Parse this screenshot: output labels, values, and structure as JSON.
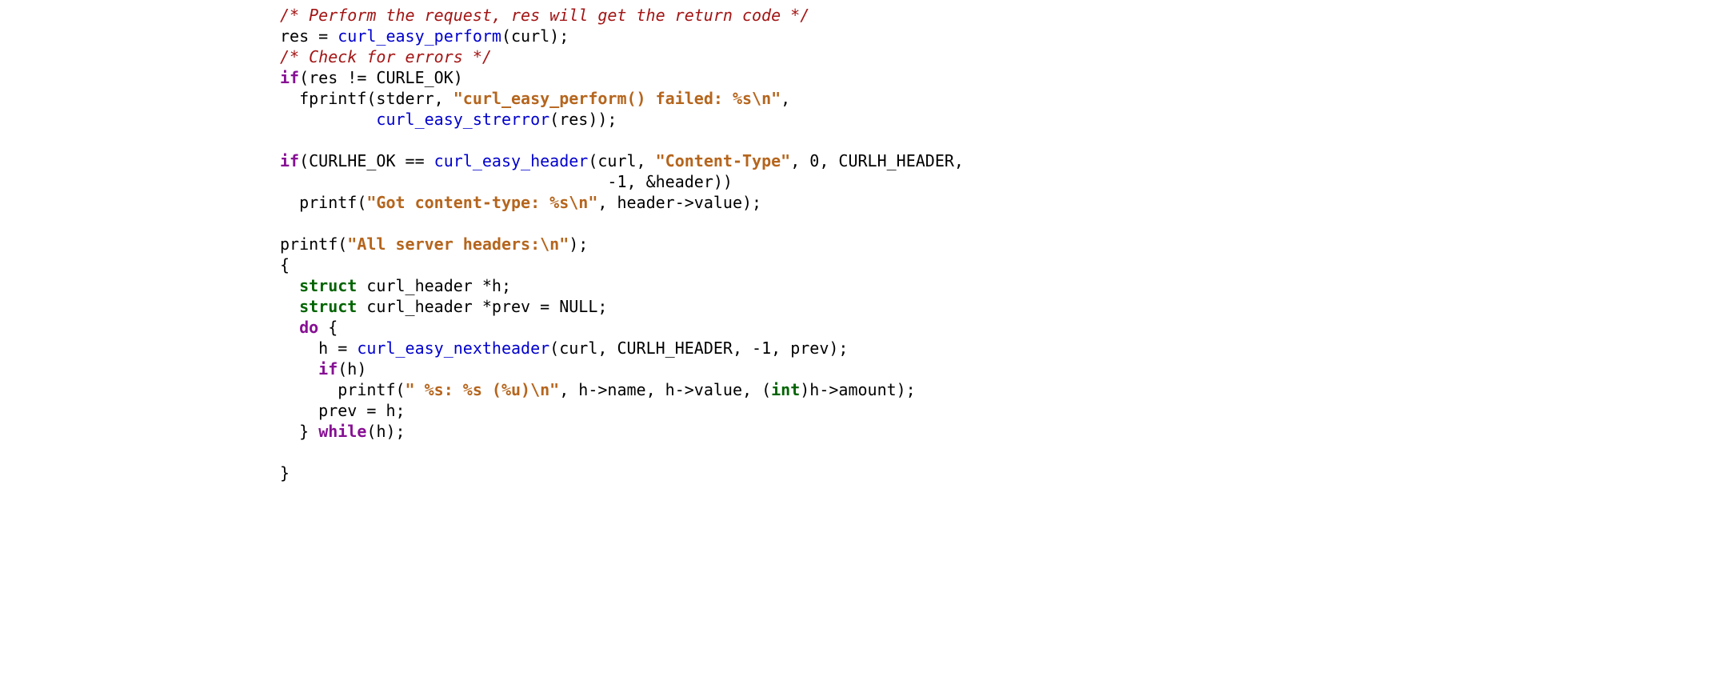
{
  "code_lines": [
    {
      "indent": "",
      "t": [
        {
          "c": "cmt",
          "s": "/* Perform the request, res will get the return code */"
        }
      ]
    },
    {
      "indent": "",
      "t": [
        {
          "c": "",
          "s": "res = "
        },
        {
          "c": "fn",
          "s": "curl_easy_perform"
        },
        {
          "c": "",
          "s": "(curl);"
        }
      ]
    },
    {
      "indent": "",
      "t": [
        {
          "c": "cmt",
          "s": "/* Check for errors */"
        }
      ]
    },
    {
      "indent": "",
      "t": [
        {
          "c": "kw",
          "s": "if"
        },
        {
          "c": "",
          "s": "(res != CURLE_OK)"
        }
      ]
    },
    {
      "indent": "  ",
      "t": [
        {
          "c": "",
          "s": "fprintf(stderr, "
        },
        {
          "c": "str",
          "s": "\"curl_easy_perform() failed: %s\\n\""
        },
        {
          "c": "",
          "s": ","
        }
      ]
    },
    {
      "indent": "          ",
      "t": [
        {
          "c": "fn",
          "s": "curl_easy_strerror"
        },
        {
          "c": "",
          "s": "(res));"
        }
      ]
    },
    {
      "indent": "",
      "t": []
    },
    {
      "indent": "",
      "t": [
        {
          "c": "kw",
          "s": "if"
        },
        {
          "c": "",
          "s": "(CURLHE_OK == "
        },
        {
          "c": "fn",
          "s": "curl_easy_header"
        },
        {
          "c": "",
          "s": "(curl, "
        },
        {
          "c": "str",
          "s": "\"Content-Type\""
        },
        {
          "c": "",
          "s": ", 0, CURLH_HEADER,"
        }
      ]
    },
    {
      "indent": "                                  ",
      "t": [
        {
          "c": "",
          "s": "-1, &header))"
        }
      ]
    },
    {
      "indent": "  ",
      "t": [
        {
          "c": "",
          "s": "printf("
        },
        {
          "c": "str",
          "s": "\"Got content-type: %s\\n\""
        },
        {
          "c": "",
          "s": ", header->value);"
        }
      ]
    },
    {
      "indent": "",
      "t": []
    },
    {
      "indent": "",
      "t": [
        {
          "c": "",
          "s": "printf("
        },
        {
          "c": "str",
          "s": "\"All server headers:\\n\""
        },
        {
          "c": "",
          "s": ");"
        }
      ]
    },
    {
      "indent": "",
      "t": [
        {
          "c": "",
          "s": "{"
        }
      ]
    },
    {
      "indent": "  ",
      "t": [
        {
          "c": "kw2",
          "s": "struct"
        },
        {
          "c": "",
          "s": " curl_header *h;"
        }
      ]
    },
    {
      "indent": "  ",
      "t": [
        {
          "c": "kw2",
          "s": "struct"
        },
        {
          "c": "",
          "s": " curl_header *prev = NULL;"
        }
      ]
    },
    {
      "indent": "  ",
      "t": [
        {
          "c": "kw",
          "s": "do"
        },
        {
          "c": "",
          "s": " {"
        }
      ]
    },
    {
      "indent": "    ",
      "t": [
        {
          "c": "",
          "s": "h = "
        },
        {
          "c": "fn",
          "s": "curl_easy_nextheader"
        },
        {
          "c": "",
          "s": "(curl, CURLH_HEADER, -1, prev);"
        }
      ]
    },
    {
      "indent": "    ",
      "t": [
        {
          "c": "kw",
          "s": "if"
        },
        {
          "c": "",
          "s": "(h)"
        }
      ]
    },
    {
      "indent": "      ",
      "t": [
        {
          "c": "",
          "s": "printf("
        },
        {
          "c": "str",
          "s": "\" %s: %s (%u)\\n\""
        },
        {
          "c": "",
          "s": ", h->name, h->value, ("
        },
        {
          "c": "kw2",
          "s": "int"
        },
        {
          "c": "",
          "s": ")h->amount);"
        }
      ]
    },
    {
      "indent": "    ",
      "t": [
        {
          "c": "",
          "s": "prev = h;"
        }
      ]
    },
    {
      "indent": "  ",
      "t": [
        {
          "c": "",
          "s": "} "
        },
        {
          "c": "kw",
          "s": "while"
        },
        {
          "c": "",
          "s": "(h);"
        }
      ]
    },
    {
      "indent": "",
      "t": []
    },
    {
      "indent": "",
      "t": [
        {
          "c": "",
          "s": "}"
        }
      ]
    }
  ]
}
